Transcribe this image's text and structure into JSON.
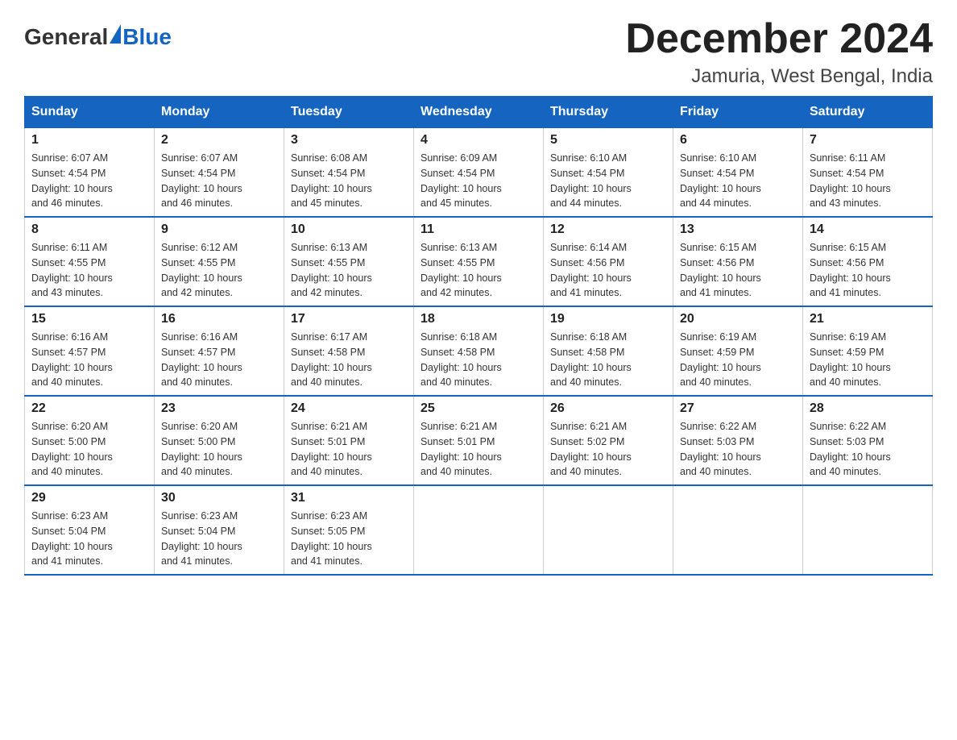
{
  "header": {
    "month_title": "December 2024",
    "location": "Jamuria, West Bengal, India",
    "logo_general": "General",
    "logo_blue": "Blue"
  },
  "days_of_week": [
    "Sunday",
    "Monday",
    "Tuesday",
    "Wednesday",
    "Thursday",
    "Friday",
    "Saturday"
  ],
  "weeks": [
    [
      {
        "day": "1",
        "sunrise": "6:07 AM",
        "sunset": "4:54 PM",
        "daylight": "10 hours and 46 minutes."
      },
      {
        "day": "2",
        "sunrise": "6:07 AM",
        "sunset": "4:54 PM",
        "daylight": "10 hours and 46 minutes."
      },
      {
        "day": "3",
        "sunrise": "6:08 AM",
        "sunset": "4:54 PM",
        "daylight": "10 hours and 45 minutes."
      },
      {
        "day": "4",
        "sunrise": "6:09 AM",
        "sunset": "4:54 PM",
        "daylight": "10 hours and 45 minutes."
      },
      {
        "day": "5",
        "sunrise": "6:10 AM",
        "sunset": "4:54 PM",
        "daylight": "10 hours and 44 minutes."
      },
      {
        "day": "6",
        "sunrise": "6:10 AM",
        "sunset": "4:54 PM",
        "daylight": "10 hours and 44 minutes."
      },
      {
        "day": "7",
        "sunrise": "6:11 AM",
        "sunset": "4:54 PM",
        "daylight": "10 hours and 43 minutes."
      }
    ],
    [
      {
        "day": "8",
        "sunrise": "6:11 AM",
        "sunset": "4:55 PM",
        "daylight": "10 hours and 43 minutes."
      },
      {
        "day": "9",
        "sunrise": "6:12 AM",
        "sunset": "4:55 PM",
        "daylight": "10 hours and 42 minutes."
      },
      {
        "day": "10",
        "sunrise": "6:13 AM",
        "sunset": "4:55 PM",
        "daylight": "10 hours and 42 minutes."
      },
      {
        "day": "11",
        "sunrise": "6:13 AM",
        "sunset": "4:55 PM",
        "daylight": "10 hours and 42 minutes."
      },
      {
        "day": "12",
        "sunrise": "6:14 AM",
        "sunset": "4:56 PM",
        "daylight": "10 hours and 41 minutes."
      },
      {
        "day": "13",
        "sunrise": "6:15 AM",
        "sunset": "4:56 PM",
        "daylight": "10 hours and 41 minutes."
      },
      {
        "day": "14",
        "sunrise": "6:15 AM",
        "sunset": "4:56 PM",
        "daylight": "10 hours and 41 minutes."
      }
    ],
    [
      {
        "day": "15",
        "sunrise": "6:16 AM",
        "sunset": "4:57 PM",
        "daylight": "10 hours and 40 minutes."
      },
      {
        "day": "16",
        "sunrise": "6:16 AM",
        "sunset": "4:57 PM",
        "daylight": "10 hours and 40 minutes."
      },
      {
        "day": "17",
        "sunrise": "6:17 AM",
        "sunset": "4:58 PM",
        "daylight": "10 hours and 40 minutes."
      },
      {
        "day": "18",
        "sunrise": "6:18 AM",
        "sunset": "4:58 PM",
        "daylight": "10 hours and 40 minutes."
      },
      {
        "day": "19",
        "sunrise": "6:18 AM",
        "sunset": "4:58 PM",
        "daylight": "10 hours and 40 minutes."
      },
      {
        "day": "20",
        "sunrise": "6:19 AM",
        "sunset": "4:59 PM",
        "daylight": "10 hours and 40 minutes."
      },
      {
        "day": "21",
        "sunrise": "6:19 AM",
        "sunset": "4:59 PM",
        "daylight": "10 hours and 40 minutes."
      }
    ],
    [
      {
        "day": "22",
        "sunrise": "6:20 AM",
        "sunset": "5:00 PM",
        "daylight": "10 hours and 40 minutes."
      },
      {
        "day": "23",
        "sunrise": "6:20 AM",
        "sunset": "5:00 PM",
        "daylight": "10 hours and 40 minutes."
      },
      {
        "day": "24",
        "sunrise": "6:21 AM",
        "sunset": "5:01 PM",
        "daylight": "10 hours and 40 minutes."
      },
      {
        "day": "25",
        "sunrise": "6:21 AM",
        "sunset": "5:01 PM",
        "daylight": "10 hours and 40 minutes."
      },
      {
        "day": "26",
        "sunrise": "6:21 AM",
        "sunset": "5:02 PM",
        "daylight": "10 hours and 40 minutes."
      },
      {
        "day": "27",
        "sunrise": "6:22 AM",
        "sunset": "5:03 PM",
        "daylight": "10 hours and 40 minutes."
      },
      {
        "day": "28",
        "sunrise": "6:22 AM",
        "sunset": "5:03 PM",
        "daylight": "10 hours and 40 minutes."
      }
    ],
    [
      {
        "day": "29",
        "sunrise": "6:23 AM",
        "sunset": "5:04 PM",
        "daylight": "10 hours and 41 minutes."
      },
      {
        "day": "30",
        "sunrise": "6:23 AM",
        "sunset": "5:04 PM",
        "daylight": "10 hours and 41 minutes."
      },
      {
        "day": "31",
        "sunrise": "6:23 AM",
        "sunset": "5:05 PM",
        "daylight": "10 hours and 41 minutes."
      },
      null,
      null,
      null,
      null
    ]
  ],
  "labels": {
    "sunrise": "Sunrise:",
    "sunset": "Sunset:",
    "daylight": "Daylight:"
  }
}
